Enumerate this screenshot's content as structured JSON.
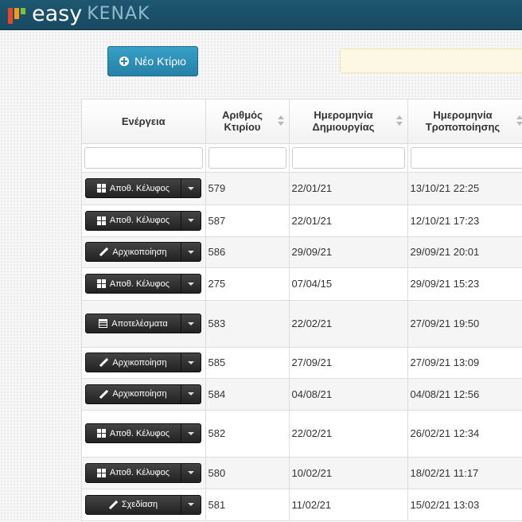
{
  "brand": {
    "easy": "easy",
    "kenak": "KENAK"
  },
  "toolbar": {
    "new_building_label": "Νέο Κτίριο",
    "new_building_icon": "plus-circle-icon"
  },
  "table": {
    "columns": [
      {
        "key": "action",
        "label": "Ενέργεια",
        "sortable": false
      },
      {
        "key": "building_no",
        "label": "Αριθμός Κτιρίου",
        "sortable": true
      },
      {
        "key": "created",
        "label": "Ημερομηνία Δημιουργίας",
        "sortable": true
      },
      {
        "key": "modified",
        "label": "Ημερομηνία Τροποποίησης",
        "sortable": true
      }
    ],
    "filters": [
      "",
      "",
      "",
      ""
    ],
    "rows": [
      {
        "action": "Αποθ. Κέλυφος",
        "icon": "grid-icon",
        "building_no": "579",
        "created": "22/01/21",
        "modified": "13/10/21 22:25"
      },
      {
        "action": "Αποθ. Κέλυφος",
        "icon": "grid-icon",
        "building_no": "587",
        "created": "22/01/21",
        "modified": "12/10/21 17:23"
      },
      {
        "action": "Αρχικοποίηση",
        "icon": "pencil-icon",
        "building_no": "586",
        "created": "29/09/21",
        "modified": "29/09/21 20:01"
      },
      {
        "action": "Αποθ. Κέλυφος",
        "icon": "grid-icon",
        "building_no": "275",
        "created": "07/04/15",
        "modified": "29/09/21 15:23"
      },
      {
        "action": "Αποτελέσματα",
        "icon": "list-icon",
        "building_no": "583",
        "created": "22/02/21",
        "modified": "27/09/21 19:50"
      },
      {
        "action": "Αρχικοποίηση",
        "icon": "pencil-icon",
        "building_no": "585",
        "created": "27/09/21",
        "modified": "27/09/21 13:09"
      },
      {
        "action": "Αρχικοποίηση",
        "icon": "pencil-icon",
        "building_no": "584",
        "created": "04/08/21",
        "modified": "04/08/21 12:56"
      },
      {
        "action": "Αποθ. Κέλυφος",
        "icon": "grid-icon",
        "building_no": "582",
        "created": "22/02/21",
        "modified": "26/02/21 12:34"
      },
      {
        "action": "Αποθ. Κέλυφος",
        "icon": "grid-icon",
        "building_no": "580",
        "created": "10/02/21",
        "modified": "18/02/21 11:17"
      },
      {
        "action": "Σχεδίαση",
        "icon": "pencil-icon",
        "building_no": "581",
        "created": "11/02/21",
        "modified": "15/02/21 13:03"
      }
    ]
  },
  "colors": {
    "header_bg": "#1f5670",
    "primary_button": "#2f91ba",
    "action_button": "#333333",
    "notice_bg": "#fcf8e3"
  }
}
